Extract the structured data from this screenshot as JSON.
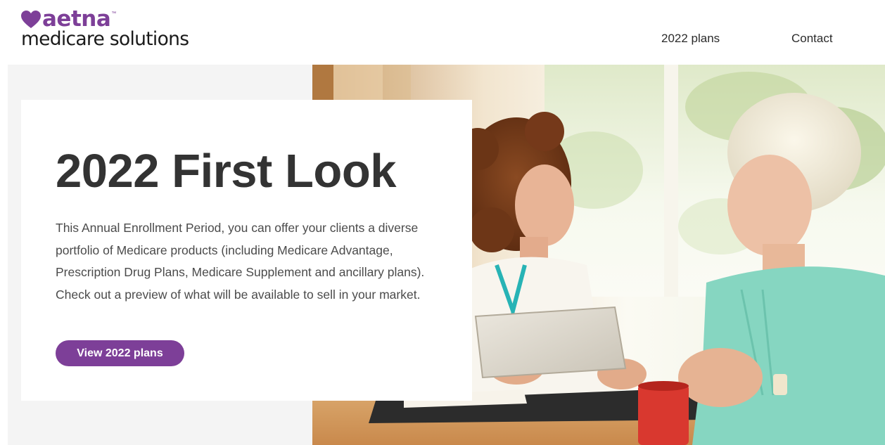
{
  "header": {
    "logo_word": "aetna",
    "logo_tm": "™",
    "logo_sub": "medicare solutions",
    "nav": [
      {
        "label": "2022 plans"
      },
      {
        "label": "Contact"
      }
    ]
  },
  "hero": {
    "title": "2022 First Look",
    "body": "This Annual Enrollment Period, you can offer your clients a diverse portfolio of Medicare products (including Medicare Advantage, Prescription Drug Plans, Medicare Supplement and ancillary plans). Check out a preview of what will be available to sell in your market.",
    "cta_label": "View 2022 plans"
  },
  "colors": {
    "brand_purple": "#7d3f98",
    "hero_background": "#f4f4f4",
    "title_text": "#333333",
    "body_text": "#4b4b4b"
  },
  "icons": {
    "logo_mark": "heart-icon"
  }
}
